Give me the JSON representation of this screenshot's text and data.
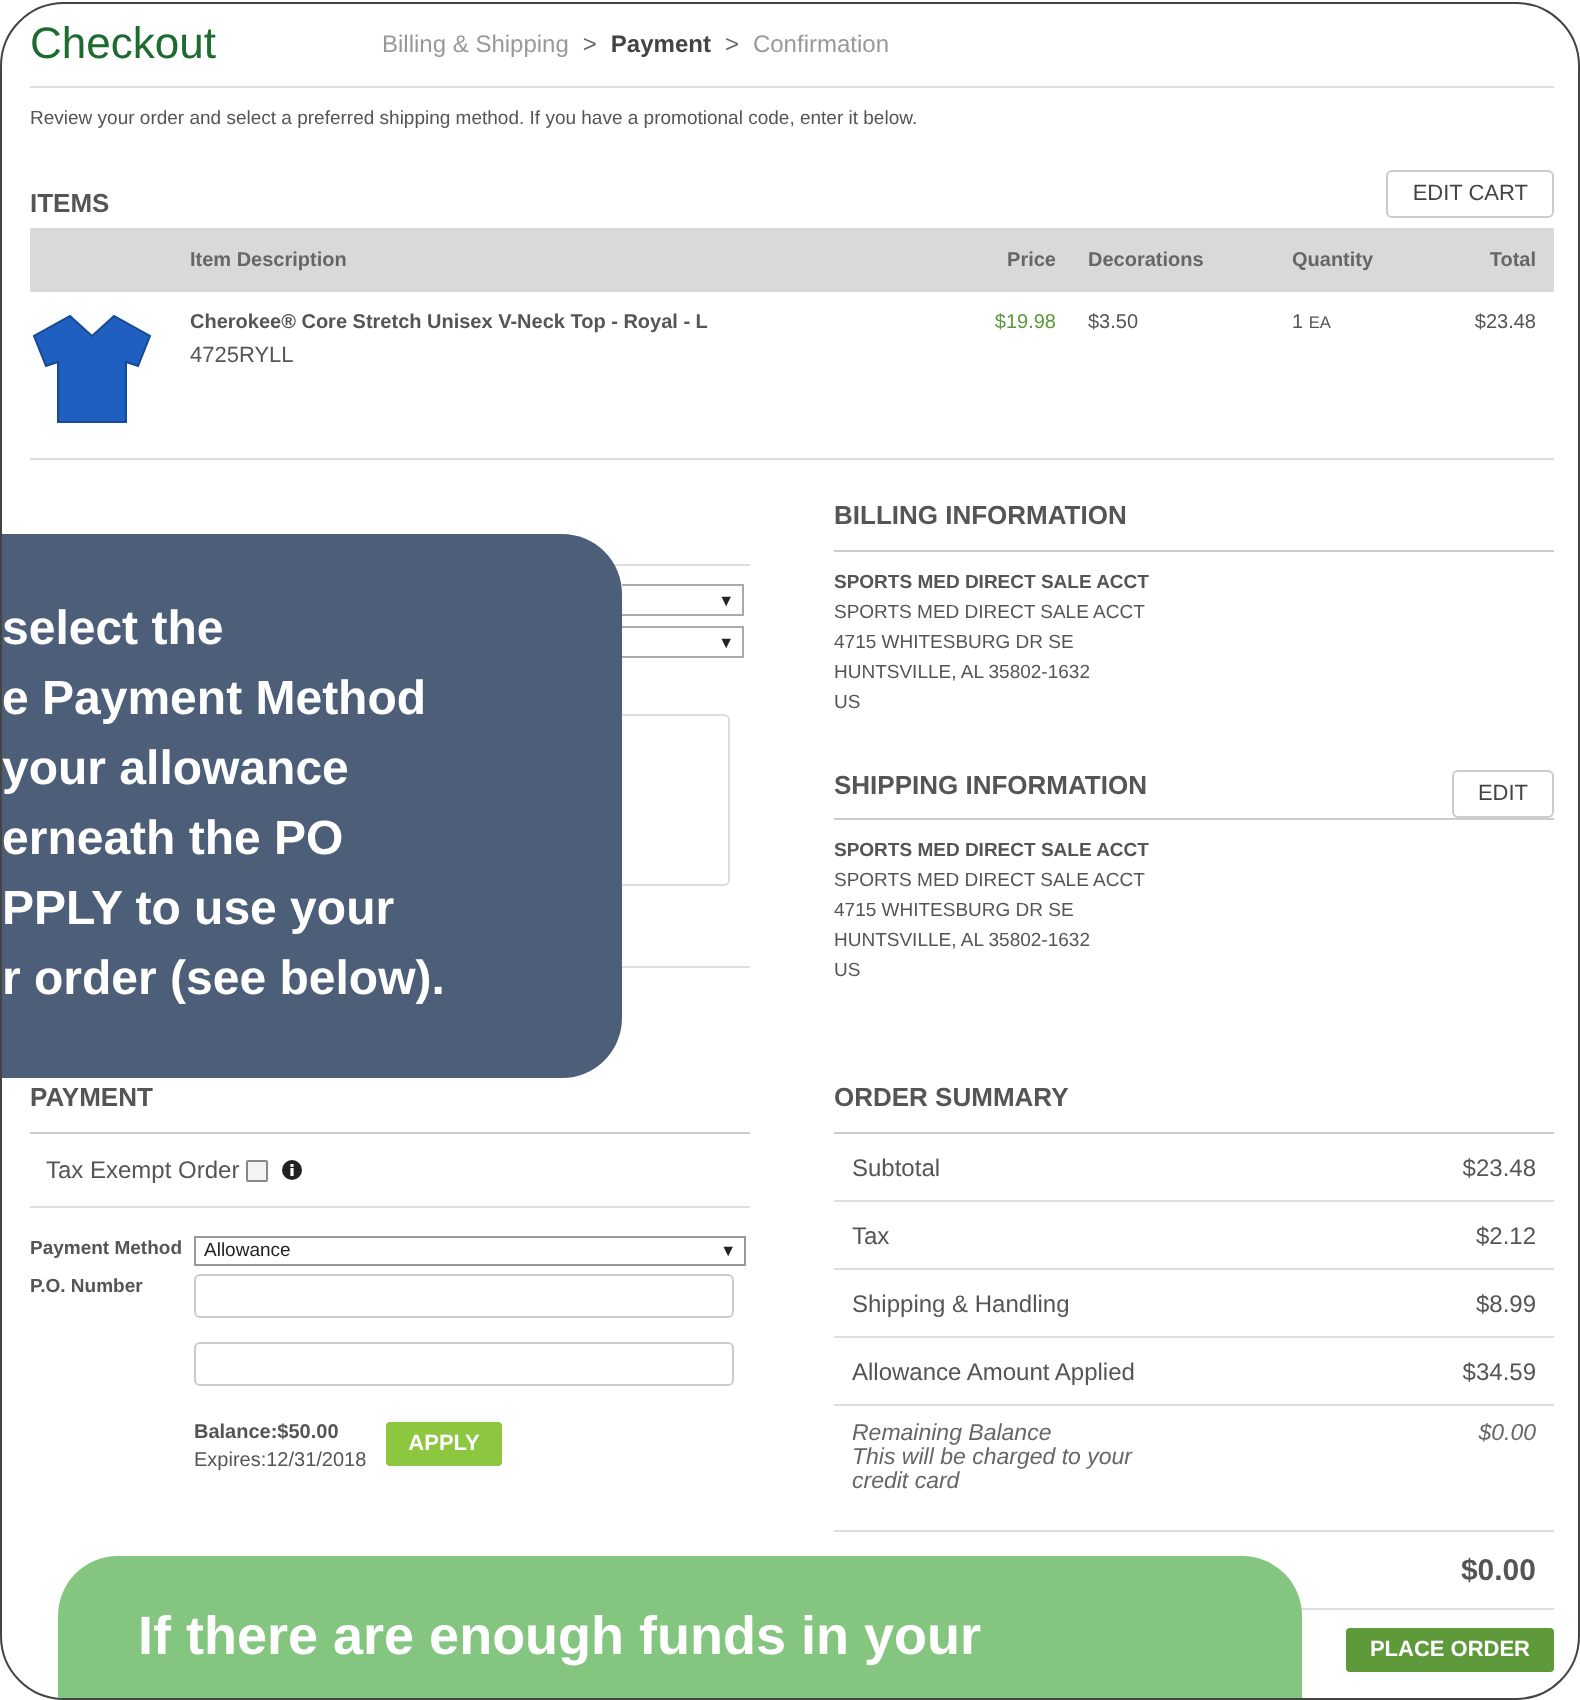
{
  "header": {
    "title": "Checkout",
    "separator": ">",
    "steps": [
      {
        "label": "Billing & Shipping",
        "selected": false
      },
      {
        "label": "Payment",
        "selected": true
      },
      {
        "label": "Confirmation",
        "selected": false
      }
    ]
  },
  "intro": "Review your order and select a preferred shipping method. If you have a promotional code, enter it below.",
  "items": {
    "title": "ITEMS",
    "edit_button": "EDIT CART",
    "columns": [
      "Item Description",
      "Price",
      "Decorations",
      "Quantity",
      "Total"
    ],
    "rows": [
      {
        "name": "Cherokee® Core Stretch Unisex V-Neck Top - Royal - L",
        "sku": "4725RYLL",
        "price": "$19.98",
        "decorations": "$3.50",
        "quantity": "1",
        "unit": "EA",
        "total": "$23.48"
      }
    ]
  },
  "shipping_method": {
    "selects": [
      {
        "arrow": "▼"
      },
      {
        "arrow": "▼"
      }
    ]
  },
  "billing": {
    "title": "BILLING INFORMATION",
    "lines": [
      "SPORTS MED DIRECT SALE ACCT",
      "SPORTS MED DIRECT SALE ACCT",
      "4715 WHITESBURG DR SE",
      "HUNTSVILLE, AL 35802-1632",
      "US"
    ]
  },
  "shipping": {
    "title": "SHIPPING INFORMATION",
    "edit_button": "EDIT",
    "lines": [
      "SPORTS MED DIRECT SALE ACCT",
      "SPORTS MED DIRECT SALE ACCT",
      "4715 WHITESBURG DR SE",
      "HUNTSVILLE, AL 35802-1632",
      "US"
    ]
  },
  "payment": {
    "title": "PAYMENT",
    "tax_exempt": {
      "label": "Tax Exempt Order",
      "checked": false
    },
    "method": {
      "label": "Payment Method",
      "value": "Allowance",
      "arrow": "▼"
    },
    "po": {
      "label": "P.O. Number"
    },
    "allowance": {
      "balance": "Balance:$50.00",
      "expires": "Expires:12/31/2018",
      "apply_button": "APPLY"
    }
  },
  "summary": {
    "title": "ORDER SUMMARY",
    "rows": [
      {
        "label": "Subtotal",
        "value": "$23.48"
      },
      {
        "label": "Tax",
        "value": "$2.12"
      },
      {
        "label": "Shipping & Handling",
        "value": "$8.99"
      },
      {
        "label": "Allowance Amount Applied",
        "value": "$34.59"
      }
    ],
    "remaining": {
      "label": "Remaining Balance",
      "note": "This will be charged to your credit card",
      "value": "$0.00"
    },
    "total": "$0.00",
    "place_order_button": "PLACE ORDER"
  },
  "callouts": [
    {
      "kind": "tip",
      "lines": [
        "select the",
        "e Payment Method",
        "your allowance",
        "erneath the PO",
        "PPLY to use your",
        "r order (see below)."
      ]
    },
    {
      "kind": "note",
      "lines": [
        "If there are enough funds in your"
      ]
    }
  ]
}
